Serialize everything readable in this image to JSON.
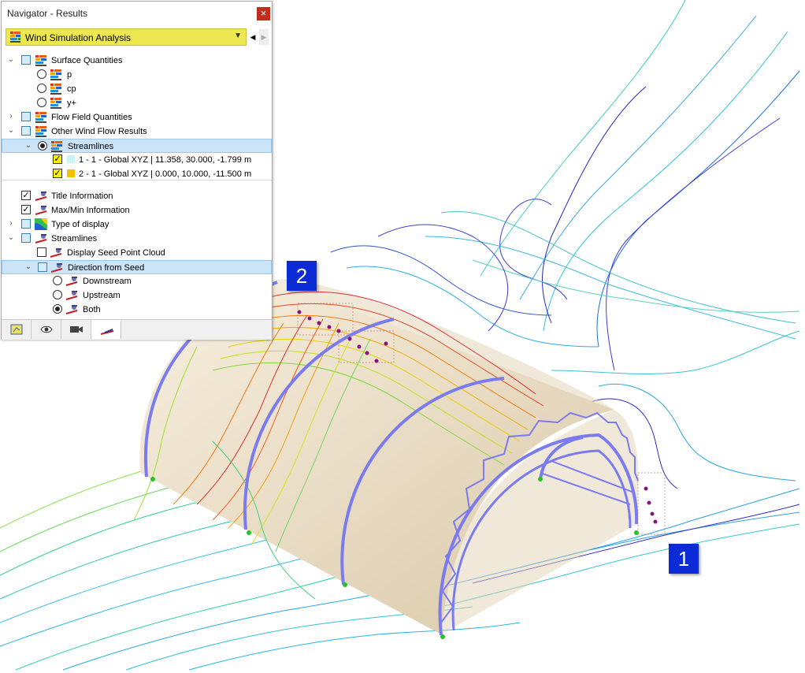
{
  "window": {
    "title": "Navigator - Results",
    "close_glyph": "×"
  },
  "combo": {
    "label": "Wind Simulation Analysis",
    "icon": "results-icon"
  },
  "tree": {
    "surface_quantities": "Surface Quantities",
    "p": "p",
    "cp": "cp",
    "yplus": "y+",
    "flow_field": "Flow Field Quantities",
    "other_wind": "Other Wind Flow Results",
    "streamlines_group": "Streamlines",
    "streamline_1": "1 - 1 - Global XYZ | 11.358, 30.000, -1.799 m",
    "streamline_2": "2 - 1 - Global XYZ | 0.000, 10.000, -11.500 m",
    "title_info": "Title Information",
    "maxmin_info": "Max/Min Information",
    "type_display": "Type of display",
    "streamlines_settings": "Streamlines",
    "seed_cloud": "Display Seed Point Cloud",
    "direction": "Direction from Seed",
    "downstream": "Downstream",
    "upstream": "Upstream",
    "both": "Both"
  },
  "colors": {
    "combo_bg": "#ede84f",
    "swatch_1": "#c8f4f4",
    "swatch_2": "#f5c200",
    "callout": "#0b2bd6",
    "arrow": "#1a3fe0",
    "truss": "#7b7bf0",
    "canopy": "#ede3cf"
  },
  "tabs": [
    "data-icon",
    "eye-icon",
    "camera-icon",
    "results-display-icon"
  ],
  "callouts": {
    "one": "1",
    "two": "2"
  }
}
